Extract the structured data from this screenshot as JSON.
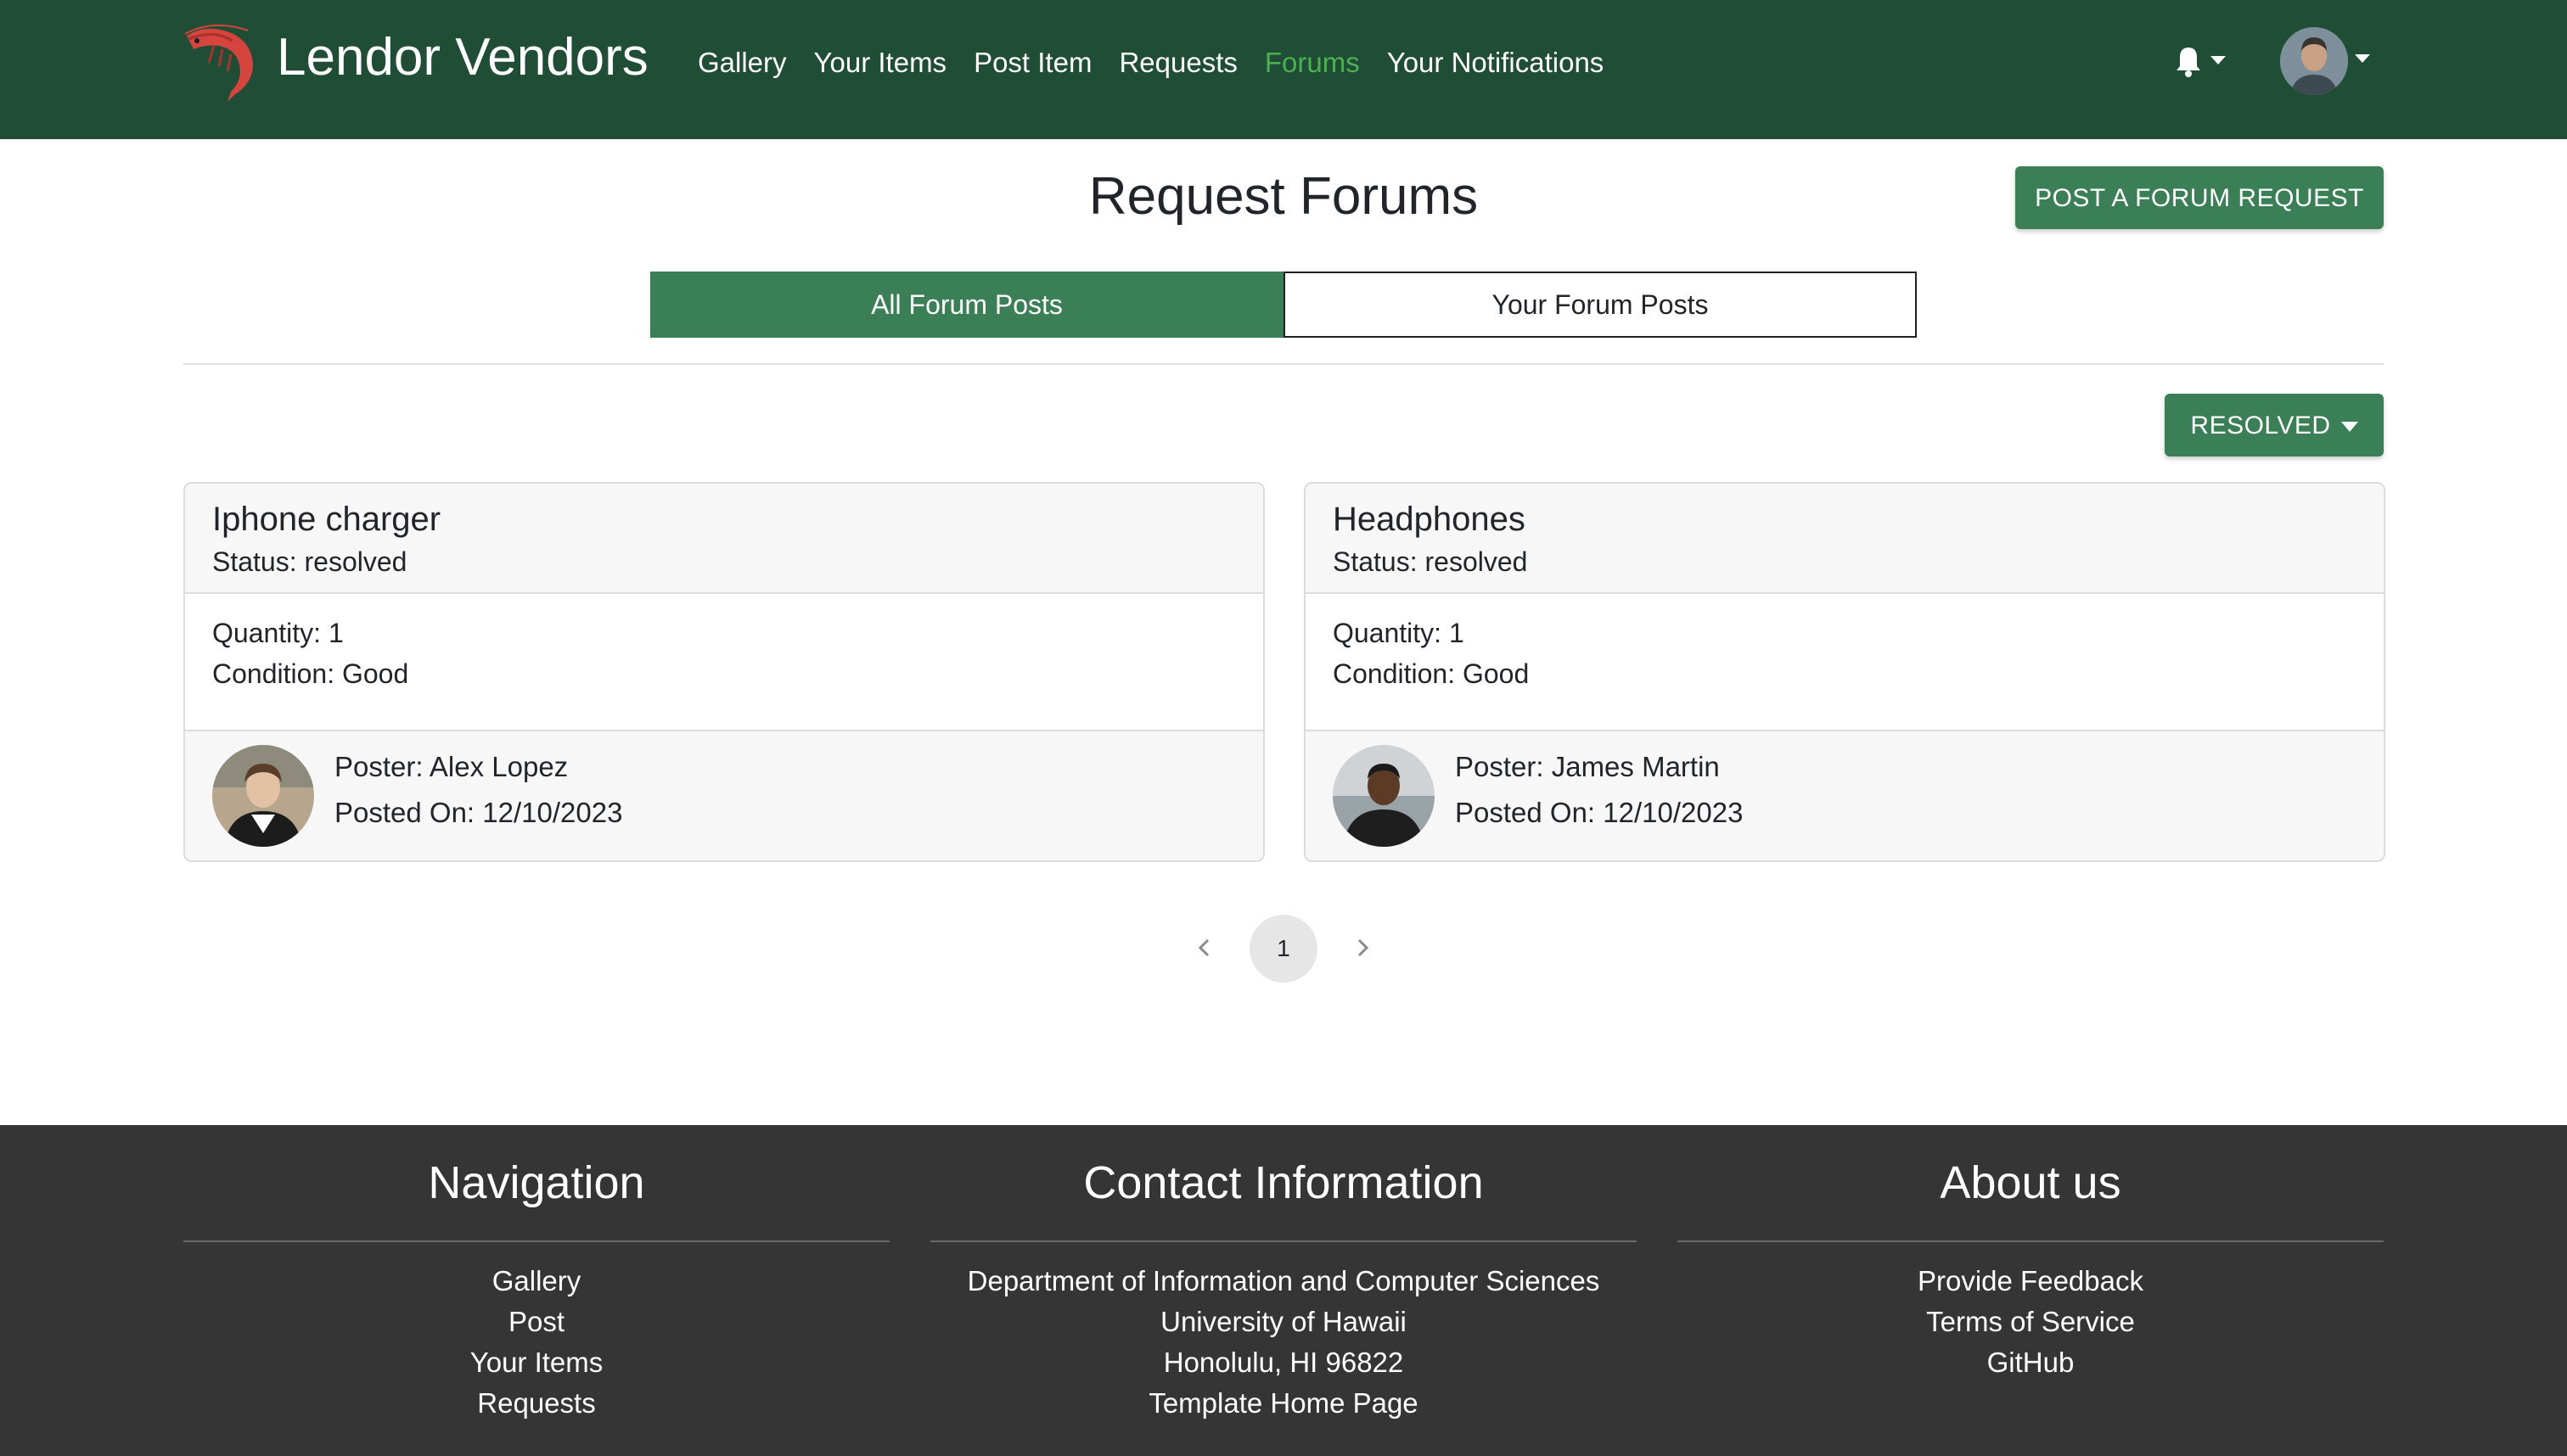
{
  "navbar": {
    "brand": "Lendor Vendors",
    "links": [
      "Gallery",
      "Your Items",
      "Post Item",
      "Requests",
      "Forums",
      "Your Notifications"
    ],
    "active_link": "Forums"
  },
  "header": {
    "title": "Request Forums",
    "post_button": "POST A FORUM REQUEST"
  },
  "tabs": [
    {
      "label": "All Forum Posts",
      "active": true
    },
    {
      "label": "Your Forum Posts",
      "active": false
    }
  ],
  "filter": {
    "label": "RESOLVED"
  },
  "posts": [
    {
      "title": "Iphone charger",
      "status": "Status: resolved",
      "quantity": "Quantity: 1",
      "condition": "Condition: Good",
      "poster": "Poster: Alex Lopez",
      "posted_on": "Posted On: 12/10/2023"
    },
    {
      "title": "Headphones",
      "status": "Status: resolved",
      "quantity": "Quantity: 1",
      "condition": "Condition: Good",
      "poster": "Poster: James Martin",
      "posted_on": "Posted On: 12/10/2023"
    }
  ],
  "pagination": {
    "current": "1"
  },
  "footer": {
    "navigation": {
      "title": "Navigation",
      "items": [
        "Gallery",
        "Post",
        "Your Items",
        "Requests"
      ]
    },
    "contact": {
      "title": "Contact Information",
      "items": [
        "Department of Information and Computer Sciences",
        "University of Hawaii",
        "Honolulu, HI 96822",
        "Template Home Page"
      ]
    },
    "about": {
      "title": "About us",
      "items": [
        "Provide Feedback",
        "Terms of Service",
        "GitHub"
      ]
    }
  },
  "colors": {
    "navbar_bg": "#1f4d36",
    "accent_green": "#3a7f56",
    "active_link": "#4caf50",
    "footer_bg": "#353535"
  },
  "icons": [
    "shrimp-logo-icon",
    "bell-icon",
    "chevron-left-icon",
    "chevron-right-icon",
    "caret-down-icon"
  ]
}
